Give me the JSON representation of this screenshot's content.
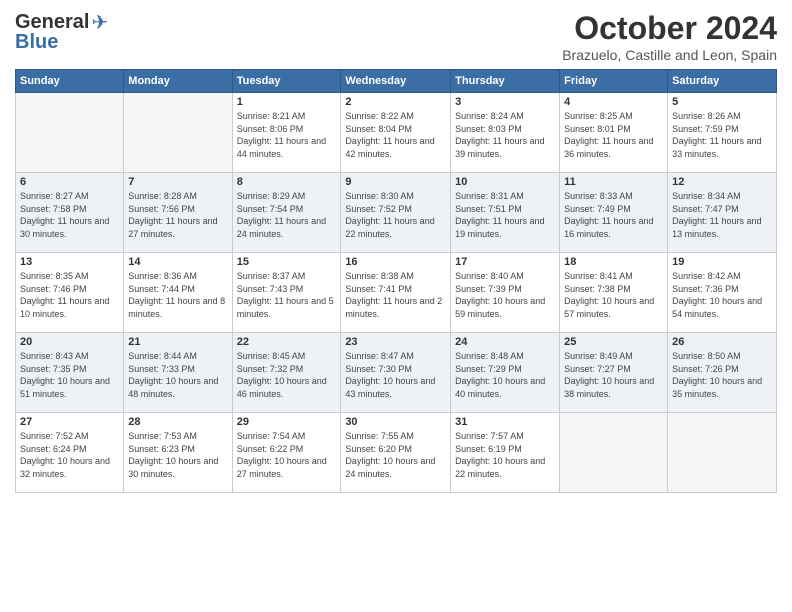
{
  "logo": {
    "general": "General",
    "blue": "Blue"
  },
  "title": "October 2024",
  "location": "Brazuelo, Castille and Leon, Spain",
  "weekdays": [
    "Sunday",
    "Monday",
    "Tuesday",
    "Wednesday",
    "Thursday",
    "Friday",
    "Saturday"
  ],
  "weeks": [
    [
      {
        "day": "",
        "info": ""
      },
      {
        "day": "",
        "info": ""
      },
      {
        "day": "1",
        "info": "Sunrise: 8:21 AM\nSunset: 8:06 PM\nDaylight: 11 hours and 44 minutes."
      },
      {
        "day": "2",
        "info": "Sunrise: 8:22 AM\nSunset: 8:04 PM\nDaylight: 11 hours and 42 minutes."
      },
      {
        "day": "3",
        "info": "Sunrise: 8:24 AM\nSunset: 8:03 PM\nDaylight: 11 hours and 39 minutes."
      },
      {
        "day": "4",
        "info": "Sunrise: 8:25 AM\nSunset: 8:01 PM\nDaylight: 11 hours and 36 minutes."
      },
      {
        "day": "5",
        "info": "Sunrise: 8:26 AM\nSunset: 7:59 PM\nDaylight: 11 hours and 33 minutes."
      }
    ],
    [
      {
        "day": "6",
        "info": "Sunrise: 8:27 AM\nSunset: 7:58 PM\nDaylight: 11 hours and 30 minutes."
      },
      {
        "day": "7",
        "info": "Sunrise: 8:28 AM\nSunset: 7:56 PM\nDaylight: 11 hours and 27 minutes."
      },
      {
        "day": "8",
        "info": "Sunrise: 8:29 AM\nSunset: 7:54 PM\nDaylight: 11 hours and 24 minutes."
      },
      {
        "day": "9",
        "info": "Sunrise: 8:30 AM\nSunset: 7:52 PM\nDaylight: 11 hours and 22 minutes."
      },
      {
        "day": "10",
        "info": "Sunrise: 8:31 AM\nSunset: 7:51 PM\nDaylight: 11 hours and 19 minutes."
      },
      {
        "day": "11",
        "info": "Sunrise: 8:33 AM\nSunset: 7:49 PM\nDaylight: 11 hours and 16 minutes."
      },
      {
        "day": "12",
        "info": "Sunrise: 8:34 AM\nSunset: 7:47 PM\nDaylight: 11 hours and 13 minutes."
      }
    ],
    [
      {
        "day": "13",
        "info": "Sunrise: 8:35 AM\nSunset: 7:46 PM\nDaylight: 11 hours and 10 minutes."
      },
      {
        "day": "14",
        "info": "Sunrise: 8:36 AM\nSunset: 7:44 PM\nDaylight: 11 hours and 8 minutes."
      },
      {
        "day": "15",
        "info": "Sunrise: 8:37 AM\nSunset: 7:43 PM\nDaylight: 11 hours and 5 minutes."
      },
      {
        "day": "16",
        "info": "Sunrise: 8:38 AM\nSunset: 7:41 PM\nDaylight: 11 hours and 2 minutes."
      },
      {
        "day": "17",
        "info": "Sunrise: 8:40 AM\nSunset: 7:39 PM\nDaylight: 10 hours and 59 minutes."
      },
      {
        "day": "18",
        "info": "Sunrise: 8:41 AM\nSunset: 7:38 PM\nDaylight: 10 hours and 57 minutes."
      },
      {
        "day": "19",
        "info": "Sunrise: 8:42 AM\nSunset: 7:36 PM\nDaylight: 10 hours and 54 minutes."
      }
    ],
    [
      {
        "day": "20",
        "info": "Sunrise: 8:43 AM\nSunset: 7:35 PM\nDaylight: 10 hours and 51 minutes."
      },
      {
        "day": "21",
        "info": "Sunrise: 8:44 AM\nSunset: 7:33 PM\nDaylight: 10 hours and 48 minutes."
      },
      {
        "day": "22",
        "info": "Sunrise: 8:45 AM\nSunset: 7:32 PM\nDaylight: 10 hours and 46 minutes."
      },
      {
        "day": "23",
        "info": "Sunrise: 8:47 AM\nSunset: 7:30 PM\nDaylight: 10 hours and 43 minutes."
      },
      {
        "day": "24",
        "info": "Sunrise: 8:48 AM\nSunset: 7:29 PM\nDaylight: 10 hours and 40 minutes."
      },
      {
        "day": "25",
        "info": "Sunrise: 8:49 AM\nSunset: 7:27 PM\nDaylight: 10 hours and 38 minutes."
      },
      {
        "day": "26",
        "info": "Sunrise: 8:50 AM\nSunset: 7:26 PM\nDaylight: 10 hours and 35 minutes."
      }
    ],
    [
      {
        "day": "27",
        "info": "Sunrise: 7:52 AM\nSunset: 6:24 PM\nDaylight: 10 hours and 32 minutes."
      },
      {
        "day": "28",
        "info": "Sunrise: 7:53 AM\nSunset: 6:23 PM\nDaylight: 10 hours and 30 minutes."
      },
      {
        "day": "29",
        "info": "Sunrise: 7:54 AM\nSunset: 6:22 PM\nDaylight: 10 hours and 27 minutes."
      },
      {
        "day": "30",
        "info": "Sunrise: 7:55 AM\nSunset: 6:20 PM\nDaylight: 10 hours and 24 minutes."
      },
      {
        "day": "31",
        "info": "Sunrise: 7:57 AM\nSunset: 6:19 PM\nDaylight: 10 hours and 22 minutes."
      },
      {
        "day": "",
        "info": ""
      },
      {
        "day": "",
        "info": ""
      }
    ]
  ]
}
